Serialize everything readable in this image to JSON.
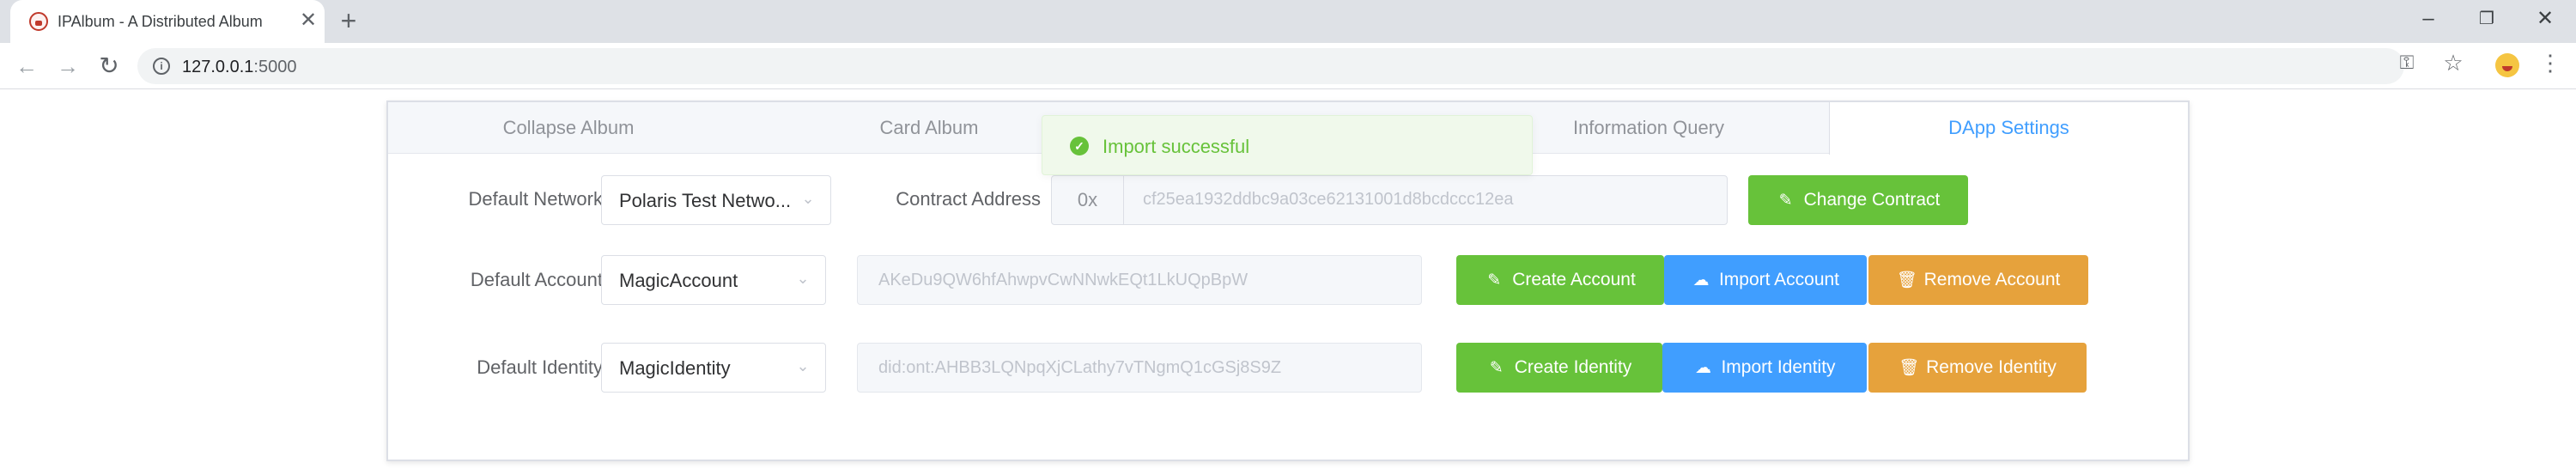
{
  "browser": {
    "tab_title": "IPAlbum - A Distributed Album",
    "url_host": "127.0.0.1",
    "url_port": ":5000"
  },
  "tabs": [
    {
      "label": "Collapse Album",
      "active": false
    },
    {
      "label": "Card Album",
      "active": false
    },
    {
      "label": "Information Query",
      "active": false
    },
    {
      "label": "DApp Settings",
      "active": true
    }
  ],
  "network": {
    "label": "Default Network",
    "selected": "Polaris Test Netwo..."
  },
  "contract": {
    "label": "Contract Address",
    "prefix": "0x",
    "value": "cf25ea1932ddbc9a03ce62131001d8bcdccc12ea",
    "button": "Change Contract"
  },
  "account": {
    "label": "Default Account",
    "selected": "MagicAccount",
    "address": "AKeDu9QW6hfAhwpvCwNNwkEQt1LkUQpBpW",
    "create_button": "Create Account",
    "import_button": "Import Account",
    "remove_button": "Remove Account"
  },
  "identity": {
    "label": "Default Identity",
    "selected": "MagicIdentity",
    "did": "did:ont:AHBB3LQNpqXjCLathy7vTNgmQ1cGSj8S9Z",
    "create_button": "Create Identity",
    "import_button": "Import Identity",
    "remove_button": "Remove Identity"
  },
  "toast": {
    "message": "Import successful"
  },
  "colors": {
    "success": "#67c23a",
    "primary": "#409eff",
    "warning": "#e6a23c"
  }
}
